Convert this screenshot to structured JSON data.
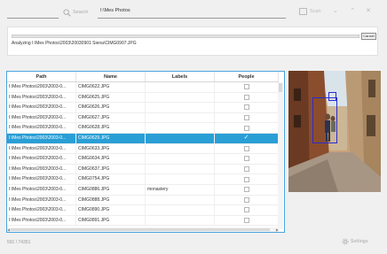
{
  "toolbar": {
    "search_label": "Search",
    "path_value": "I:\\Mes Photos",
    "scan_label": "Scan"
  },
  "progress": {
    "fraction": 0.0,
    "cancel_label": "Cancel",
    "status": "Analyzing I:\\Mes Photos\\2003\\20030901 Siena\\CIMG0907.JPG"
  },
  "table": {
    "columns": [
      "Path",
      "Name",
      "Labels",
      "People"
    ],
    "rows": [
      {
        "path": "I:\\Mes Photos\\2003\\2003-0...",
        "name": "CIMG0622.JPG",
        "labels": "",
        "people": false
      },
      {
        "path": "I:\\Mes Photos\\2003\\2003-0...",
        "name": "CIMG0625.JPG",
        "labels": "",
        "people": false
      },
      {
        "path": "I:\\Mes Photos\\2003\\2003-0...",
        "name": "CIMG0626.JPG",
        "labels": "",
        "people": false
      },
      {
        "path": "I:\\Mes Photos\\2003\\2003-0...",
        "name": "CIMG0627.JPG",
        "labels": "",
        "people": false
      },
      {
        "path": "I:\\Mes Photos\\2003\\2003-0...",
        "name": "CIMG0628.JPG",
        "labels": "",
        "people": false
      },
      {
        "path": "I:\\Mes Photos\\2003\\2003-0...",
        "name": "CIMG0629.JPG",
        "labels": "",
        "people": true
      },
      {
        "path": "I:\\Mes Photos\\2003\\2003-0...",
        "name": "CIMG0633.JPG",
        "labels": "",
        "people": false
      },
      {
        "path": "I:\\Mes Photos\\2003\\2003-0...",
        "name": "CIMG0634.JPG",
        "labels": "",
        "people": false
      },
      {
        "path": "I:\\Mes Photos\\2003\\2003-0...",
        "name": "CIMG0637.JPG",
        "labels": "",
        "people": false
      },
      {
        "path": "I:\\Mes Photos\\2003\\2003-0...",
        "name": "CIMG0754.JPG",
        "labels": "",
        "people": false
      },
      {
        "path": "I:\\Mes Photos\\2003\\2003-0...",
        "name": "CIMG0886.JPG",
        "labels": "monastery",
        "people": false
      },
      {
        "path": "I:\\Mes Photos\\2003\\2003-0...",
        "name": "CIMG0888.JPG",
        "labels": "",
        "people": false
      },
      {
        "path": "I:\\Mes Photos\\2003\\2003-0...",
        "name": "CIMG0890.JPG",
        "labels": "",
        "people": false
      },
      {
        "path": "I:\\Mes Photos\\2003\\2003-0...",
        "name": "CIMG0891.JPG",
        "labels": "",
        "people": false
      }
    ],
    "selected_index": 5
  },
  "footer": {
    "count": "591 / 74351",
    "settings_label": "Settings"
  },
  "colors": {
    "selection": "#2a9fd6",
    "face_box": "#2a2ad4"
  }
}
